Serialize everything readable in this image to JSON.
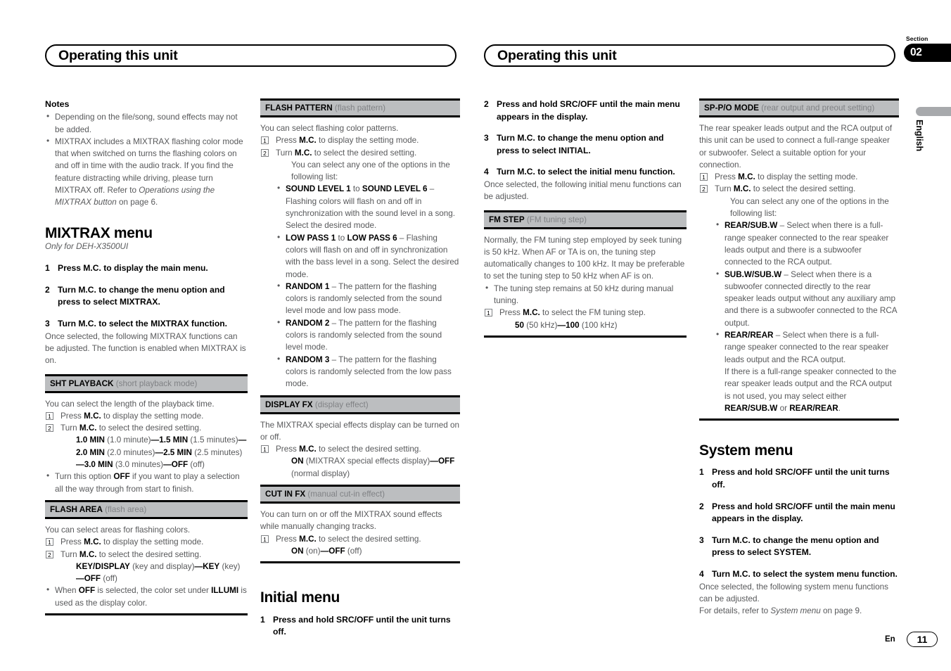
{
  "header": {
    "left_title": "Operating this unit",
    "right_title": "Operating this unit",
    "section_label": "Section",
    "section_number": "02",
    "language_tab": "English"
  },
  "footer": {
    "lang_code": "En",
    "page_number": "11"
  },
  "col1": {
    "notes_heading": "Notes",
    "note1": "Depending on the file/song, sound effects may not be added.",
    "note2_a": "MIXTRAX includes a MIXTRAX flashing color mode that when switched on turns the flashing colors on and off in time with the audio track. If you find the feature distracting while driving, please turn MIXTRAX off. Refer to ",
    "note2_ital": "Operations using the MIXTRAX button",
    "note2_b": " on page 6.",
    "title": "MIXTRAX menu",
    "subtitle": "Only for DEH-X3500UI",
    "step1_n": "1",
    "step1_t": "Press M.C. to display the main menu.",
    "step2_n": "2",
    "step2_t": "Turn M.C. to change the menu option and press to select MIXTRAX.",
    "step3_n": "3",
    "step3_t": "Turn M.C. to select the MIXTRAX function.",
    "step3_body": "Once selected, the following MIXTRAX functions can be adjusted. The function is enabled when MIXTRAX is on.",
    "sht": {
      "name": "SHT PLAYBACK",
      "desc_paren": "(short playback mode)",
      "intro": "You can select the length of the playback time.",
      "i1_pre": "Press ",
      "i1_b": "M.C.",
      "i1_post": " to display the setting mode.",
      "i2_pre": "Turn ",
      "i2_b": "M.C.",
      "i2_post": " to select the desired setting.",
      "opt_v1": "1.0 MIN",
      "opt_p1": "(1.0 minute)",
      "opt_v2": "1.5 MIN",
      "opt_p2": "(1.5 minutes)",
      "opt_v3": "2.0 MIN",
      "opt_p3": "(2.0 minutes)",
      "opt_v4": "2.5 MIN",
      "opt_p4": "(2.5 minutes)",
      "opt_v5": "3.0 MIN",
      "opt_p5": "(3.0 minutes)",
      "opt_v6": "OFF",
      "opt_p6": "(off)",
      "bullet_pre": "Turn this option ",
      "bullet_b": "OFF",
      "bullet_post": " if you want to play a selection all the way through from start to finish."
    },
    "flash_area": {
      "name": "FLASH AREA",
      "desc_paren": "(flash area)",
      "intro": "You can select areas for flashing colors.",
      "i1_pre": "Press ",
      "i1_b": "M.C.",
      "i1_post": " to display the setting mode.",
      "i2_pre": "Turn ",
      "i2_b": "M.C.",
      "i2_post": " to select the desired setting.",
      "opt_v1": "KEY/DISPLAY",
      "opt_p1": "(key and display)",
      "opt_v2": "KEY",
      "opt_p2": "(key)",
      "opt_v3": "OFF",
      "opt_p3": "(off)",
      "bullet_pre": "When ",
      "bullet_b1": "OFF",
      "bullet_mid": " is selected, the color set under ",
      "bullet_b2": "ILLUMI",
      "bullet_post": " is used as the display color."
    }
  },
  "col2": {
    "flash_pattern": {
      "name": "FLASH PATTERN",
      "desc_paren": "(flash pattern)",
      "intro": "You can select flashing color patterns.",
      "i1_pre": "Press ",
      "i1_b": "M.C.",
      "i1_post": " to display the setting mode.",
      "i2_pre": "Turn ",
      "i2_b": "M.C.",
      "i2_post": " to select the desired setting.",
      "i2_cont": "You can select any one of the options in the following list:",
      "opt1_b1": "SOUND LEVEL 1",
      "opt1_mid": " to ",
      "opt1_b2": "SOUND LEVEL 6",
      "opt1_post": " – Flashing colors will flash on and off in synchronization with the sound level in a song. Select the desired mode.",
      "opt2_b1": "LOW PASS 1",
      "opt2_mid": " to ",
      "opt2_b2": "LOW PASS 6",
      "opt2_post": " – Flashing colors will flash on and off in synchronization with the bass level in a song. Select the desired mode.",
      "opt3_b": "RANDOM 1",
      "opt3_post": " – The pattern for the flashing colors is randomly selected from the sound level mode and low pass mode.",
      "opt4_b": "RANDOM 2",
      "opt4_post": " – The pattern for the flashing colors is randomly selected from the sound level mode.",
      "opt5_b": "RANDOM 3",
      "opt5_post": " – The pattern for the flashing colors is randomly selected from the low pass mode."
    },
    "display_fx": {
      "name": "DISPLAY FX",
      "desc_paren": "(display effect)",
      "intro": "The MIXTRAX special effects display can be turned on or off.",
      "i1_pre": "Press ",
      "i1_b": "M.C.",
      "i1_post": " to select the desired setting.",
      "opt_v1": "ON",
      "opt_p1": "(MIXTRAX special effects display)",
      "opt_v2": "OFF",
      "opt_p2": "(normal display)"
    },
    "cut_in_fx": {
      "name": "CUT IN FX",
      "desc_paren": "(manual cut-in effect)",
      "intro": "You can turn on or off the MIXTRAX sound effects while manually changing tracks.",
      "i1_pre": "Press ",
      "i1_b": "M.C.",
      "i1_post": " to select the desired setting.",
      "opt_v1": "ON",
      "opt_p1": "(on)",
      "opt_v2": "OFF",
      "opt_p2": "(off)"
    },
    "initial": {
      "title": "Initial menu",
      "step1_n": "1",
      "step1_t": "Press and hold SRC/OFF until the unit turns off."
    }
  },
  "col3": {
    "step2_n": "2",
    "step2_t": "Press and hold SRC/OFF until the main menu appears in the display.",
    "step3_n": "3",
    "step3_t": "Turn M.C. to change the menu option and press to select INITIAL.",
    "step4_n": "4",
    "step4_t": "Turn M.C. to select the initial menu function.",
    "step4_body": "Once selected, the following initial menu functions can be adjusted.",
    "fm_step": {
      "name": "FM STEP",
      "desc_paren": "(FM tuning step)",
      "intro": "Normally, the FM tuning step employed by seek tuning is 50 kHz. When AF or TA is on, the tuning step automatically changes to 100 kHz. It may be preferable to set the tuning step to 50 kHz when AF is on.",
      "bullet": "The tuning step remains at 50 kHz during manual tuning.",
      "i1_pre": "Press ",
      "i1_b": "M.C.",
      "i1_post": " to select the FM tuning step.",
      "opt_v1": "50",
      "opt_p1": "(50 kHz)",
      "opt_v2": "100",
      "opt_p2": "(100 kHz)"
    }
  },
  "col4": {
    "sp_po": {
      "name": "SP-P/O MODE",
      "desc_paren": "(rear output and preout setting)",
      "intro": "The rear speaker leads output and the RCA output of this unit can be used to connect a full-range speaker or subwoofer. Select a suitable option for your connection.",
      "i1_pre": "Press ",
      "i1_b": "M.C.",
      "i1_post": " to display the setting mode.",
      "i2_pre": "Turn ",
      "i2_b": "M.C.",
      "i2_post": " to select the desired setting.",
      "i2_cont": "You can select any one of the options in the following list:",
      "opt1_b": "REAR/SUB.W",
      "opt1_post": " – Select when there is a full-range speaker connected to the rear speaker leads output and there is a subwoofer connected to the RCA output.",
      "opt2_b": "SUB.W/SUB.W",
      "opt2_post": " – Select when there is a subwoofer connected directly to the rear speaker leads output without any auxiliary amp and there is a subwoofer connected to the RCA output.",
      "opt3_b": "REAR/REAR",
      "opt3_post": " – Select when there is a full-range speaker connected to the rear speaker leads output and the RCA output.",
      "opt3_extra_a": "If there is a full-range speaker connected to the rear speaker leads output and the RCA output is not used, you may select either ",
      "opt3_extra_b1": "REAR/SUB.W",
      "opt3_extra_mid": " or ",
      "opt3_extra_b2": "REAR/REAR",
      "opt3_extra_end": "."
    },
    "system": {
      "title": "System menu",
      "step1_n": "1",
      "step1_t": "Press and hold SRC/OFF until the unit turns off.",
      "step2_n": "2",
      "step2_t": "Press and hold SRC/OFF until the main menu appears in the display.",
      "step3_n": "3",
      "step3_t": "Turn M.C. to change the menu option and press to select SYSTEM.",
      "step4_n": "4",
      "step4_t": "Turn M.C. to select the system menu function.",
      "step4_body": "Once selected, the following system menu functions can be adjusted.",
      "step4_ref_a": "For details, refer to ",
      "step4_ref_ital": "System menu",
      "step4_ref_b": " on page 9."
    }
  }
}
